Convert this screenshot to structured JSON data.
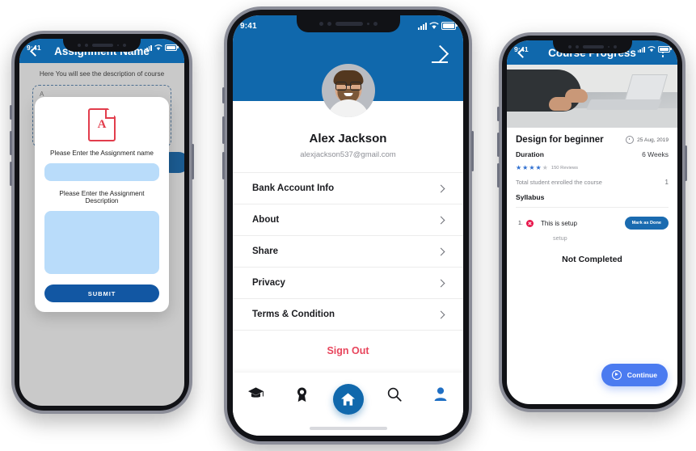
{
  "phone1": {
    "status": {
      "time": "9:41",
      "signal": "signal-bars",
      "wifi": "wifi-icon",
      "battery": "battery-icon"
    },
    "appbar": {
      "back": "back-chevron",
      "title": "Assignment Name"
    },
    "description": "Here You will see the description of course",
    "ghost_field_text": "A",
    "modal": {
      "doc_icon": "pdf-file-icon",
      "name_label": "Please Enter the Assignment name",
      "name_value": "",
      "desc_label": "Please Enter the Assignment Description",
      "desc_value": "",
      "submit_label": "SUBMIT"
    }
  },
  "phone2": {
    "status": {
      "time": "9:41",
      "signal": "signal-bars",
      "wifi": "wifi-icon",
      "battery": "battery-icon"
    },
    "edit_icon": "edit-pencil-icon",
    "profile": {
      "avatar": "user-avatar-photo",
      "name": "Alex Jackson",
      "email": "alexjackson537@gmail.com"
    },
    "menu": [
      {
        "label": "Bank Account Info",
        "chevron": "chevron-right-icon"
      },
      {
        "label": "About",
        "chevron": "chevron-right-icon"
      },
      {
        "label": "Share",
        "chevron": "chevron-right-icon"
      },
      {
        "label": "Privacy",
        "chevron": "chevron-right-icon"
      },
      {
        "label": "Terms & Condition",
        "chevron": "chevron-right-icon"
      }
    ],
    "sign_out": "Sign Out",
    "nav": [
      {
        "icon": "graduation-cap-icon",
        "active": false
      },
      {
        "icon": "award-badge-icon",
        "active": false
      },
      {
        "icon": "home-icon",
        "active": true
      },
      {
        "icon": "search-icon",
        "active": false
      },
      {
        "icon": "person-icon",
        "active": true
      }
    ]
  },
  "phone3": {
    "status": {
      "time": "9:41",
      "signal": "signal-bars",
      "wifi": "wifi-icon",
      "battery": "battery-icon"
    },
    "appbar": {
      "back": "back-chevron",
      "title": "Course Progress",
      "menu": "kebab-menu-icon"
    },
    "cover_image": "hands-typing-on-laptop",
    "course": {
      "title": "Design for beginner",
      "date": "25 Aug, 2019",
      "date_icon": "clock-icon",
      "duration_label": "Duration",
      "duration_value": "6 Weeks",
      "rating": 4,
      "rating_max": 5,
      "reviews": "150 Reviews",
      "enrolled_label": "Total student enrolled the course",
      "enrolled_count": "1"
    },
    "syllabus_label": "Syllabus",
    "syllabus_items": [
      {
        "index": "1.",
        "status_icon": "not-done-x-icon",
        "name": "This is setup",
        "subtitle": "setup",
        "action_label": "Mark as Done"
      }
    ],
    "completion_status": "Not Completed",
    "continue": {
      "icon": "play-circle-icon",
      "label": "Continue"
    }
  },
  "colors": {
    "header_blue": "#1068ac",
    "submit_blue": "#1257a3",
    "input_blue": "#b9dcfa",
    "signout_red": "#e8455c",
    "continue_blue": "#4b7bf0",
    "error_red": "#e8154b",
    "star_blue": "#2f6fd0",
    "screen_gray": "#c9c9c9"
  }
}
